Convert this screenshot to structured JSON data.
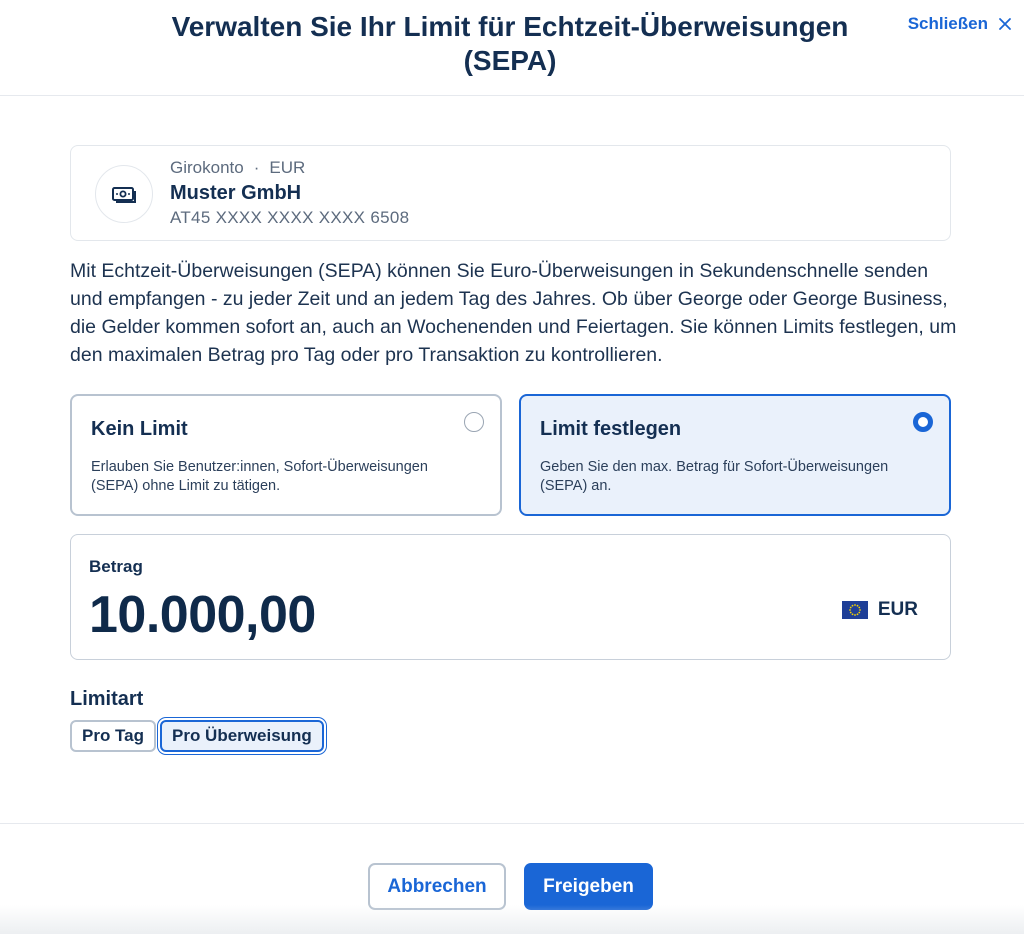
{
  "header": {
    "title": "Verwalten Sie Ihr Limit für Echtzeit-Überweisungen (SEPA)",
    "close_label": "Schließen"
  },
  "account": {
    "type": "Girokonto",
    "separator": "·",
    "currency": "EUR",
    "name": "Muster GmbH",
    "iban": "AT45 XXXX XXXX XXXX 6508",
    "icon": "banknote-icon"
  },
  "description": "Mit Echtzeit-Überweisungen (SEPA) können Sie Euro-Überweisungen in Sekundenschnelle senden und empfangen - zu jeder Zeit und an jedem Tag des Jahres. Ob über George oder George Business, die Gelder kommen sofort an, auch an Wochenenden und Feiertagen. Sie können Limits festlegen, um den maximalen Betrag pro Tag oder pro Transaktion zu kontrollieren.",
  "options": [
    {
      "title": "Kein Limit",
      "text": "Erlauben Sie Benutzer:innen, Sofort-Überweisungen (SEPA) ohne Limit zu tätigen.",
      "selected": false
    },
    {
      "title": "Limit festlegen",
      "text": "Geben Sie den max. Betrag für Sofort-Überweisungen (SEPA) an.",
      "selected": true
    }
  ],
  "amount": {
    "label": "Betrag",
    "value": "10.000,00",
    "currency": "EUR",
    "flag_icon": "eu-flag-icon"
  },
  "limit_type": {
    "label": "Limitart",
    "chips": [
      {
        "label": "Pro Tag",
        "selected": false
      },
      {
        "label": "Pro Überweisung",
        "selected": true
      }
    ]
  },
  "footer": {
    "cancel_label": "Abbrechen",
    "submit_label": "Freigeben"
  },
  "colors": {
    "accent": "#1a66d6",
    "text_dark": "#142f52",
    "selected_bg": "#eaf1fb"
  }
}
